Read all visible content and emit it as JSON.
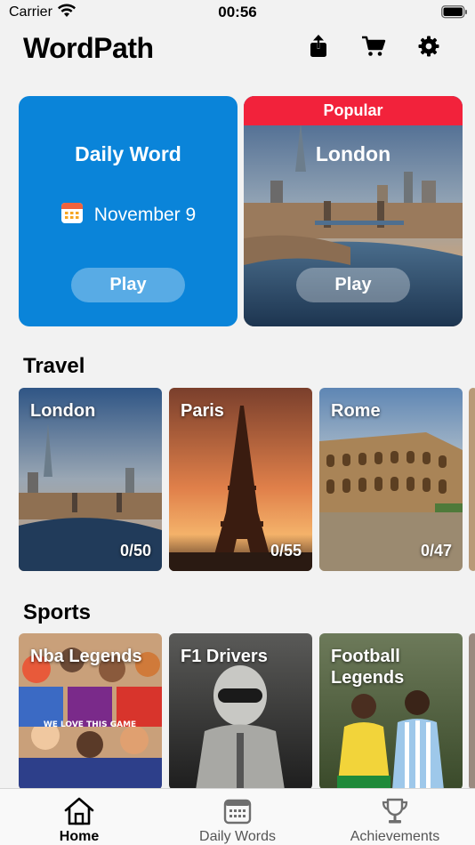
{
  "status_bar": {
    "carrier": "Carrier",
    "time": "00:56"
  },
  "header": {
    "title": "WordPath"
  },
  "daily_card": {
    "title": "Daily Word",
    "date": "November 9",
    "play_label": "Play"
  },
  "popular_card": {
    "banner": "Popular",
    "title": "London",
    "play_label": "Play"
  },
  "travel": {
    "title": "Travel",
    "items": [
      {
        "name": "London",
        "progress": "0/50"
      },
      {
        "name": "Paris",
        "progress": "0/55"
      },
      {
        "name": "Rome",
        "progress": "0/47"
      }
    ]
  },
  "sports": {
    "title": "Sports",
    "items": [
      {
        "name": "Nba Legends",
        "poster_text": "WE LOVE THIS GAME"
      },
      {
        "name": "F1 Drivers"
      },
      {
        "name": "Football Legends"
      }
    ]
  },
  "tab_bar": {
    "items": [
      {
        "label": "Home",
        "icon": "home-icon",
        "active": true
      },
      {
        "label": "Daily Words",
        "icon": "calendar-icon",
        "active": false
      },
      {
        "label": "Achievements",
        "icon": "trophy-icon",
        "active": false
      }
    ]
  },
  "colors": {
    "daily_card": "#0a84d9",
    "popular_banner": "#f2223b",
    "background": "#f2f2f2"
  }
}
